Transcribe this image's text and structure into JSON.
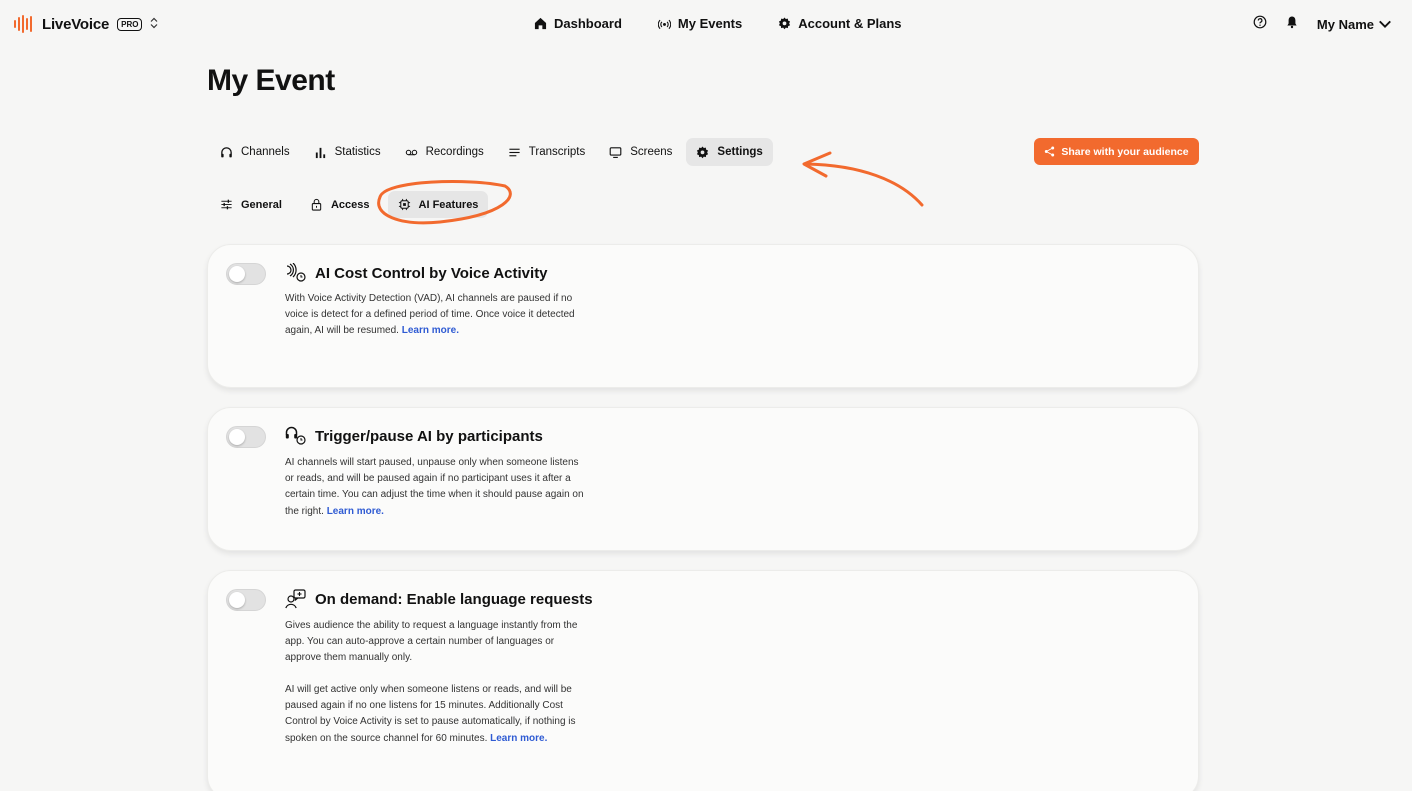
{
  "app": {
    "brand": "LiveVoice",
    "badge": "PRO",
    "switcher": "⌃⌄"
  },
  "topnav": [
    {
      "label": "Dashboard",
      "icon": "home-icon"
    },
    {
      "label": "My Events",
      "icon": "broadcast-icon"
    },
    {
      "label": "Account & Plans",
      "icon": "gear-icon"
    }
  ],
  "user": {
    "name": "My Name"
  },
  "page": {
    "title": "My Event"
  },
  "tabs": [
    {
      "label": "Channels",
      "icon": "headphones-icon"
    },
    {
      "label": "Statistics",
      "icon": "bar-chart-icon"
    },
    {
      "label": "Recordings",
      "icon": "voicemail-icon"
    },
    {
      "label": "Transcripts",
      "icon": "lines-icon"
    },
    {
      "label": "Screens",
      "icon": "monitor-icon"
    },
    {
      "label": "Settings",
      "icon": "gear-icon",
      "active": true
    }
  ],
  "share_button": "Share with your audience",
  "subtabs": [
    {
      "label": "General",
      "icon": "sliders-icon"
    },
    {
      "label": "Access",
      "icon": "lock-icon"
    },
    {
      "label": "AI Features",
      "icon": "chip-icon",
      "active": true
    }
  ],
  "cards": [
    {
      "title": "AI Cost Control by Voice Activity",
      "description": "With Voice Activity Detection (VAD), AI channels are paused if no voice is detect for a defined period of time. Once voice it detected again, AI will be resumed.",
      "link": "Learn more.",
      "enabled": false
    },
    {
      "title": "Trigger/pause AI by participants",
      "description": "AI channels will start paused, unpause only when someone listens or reads, and will be paused again if no participant uses it after a certain time. You can adjust the time when it should pause again on the right.",
      "link": "Learn more.",
      "enabled": false
    },
    {
      "title": "On demand: Enable language requests",
      "description": "Gives audience the ability to request a language instantly from the app. You can auto-approve a certain number of languages or approve them manually only.",
      "description2": "AI will get active only when someone listens or reads, and will be paused again if no one listens for 15 minutes. Additionally Cost Control by Voice Activity is set to pause automatically, if nothing is spoken on the source channel for 60 minutes.",
      "link": "Learn more.",
      "enabled": false
    }
  ],
  "colors": {
    "accent": "#f26a2e",
    "link": "#2f5bd3"
  }
}
